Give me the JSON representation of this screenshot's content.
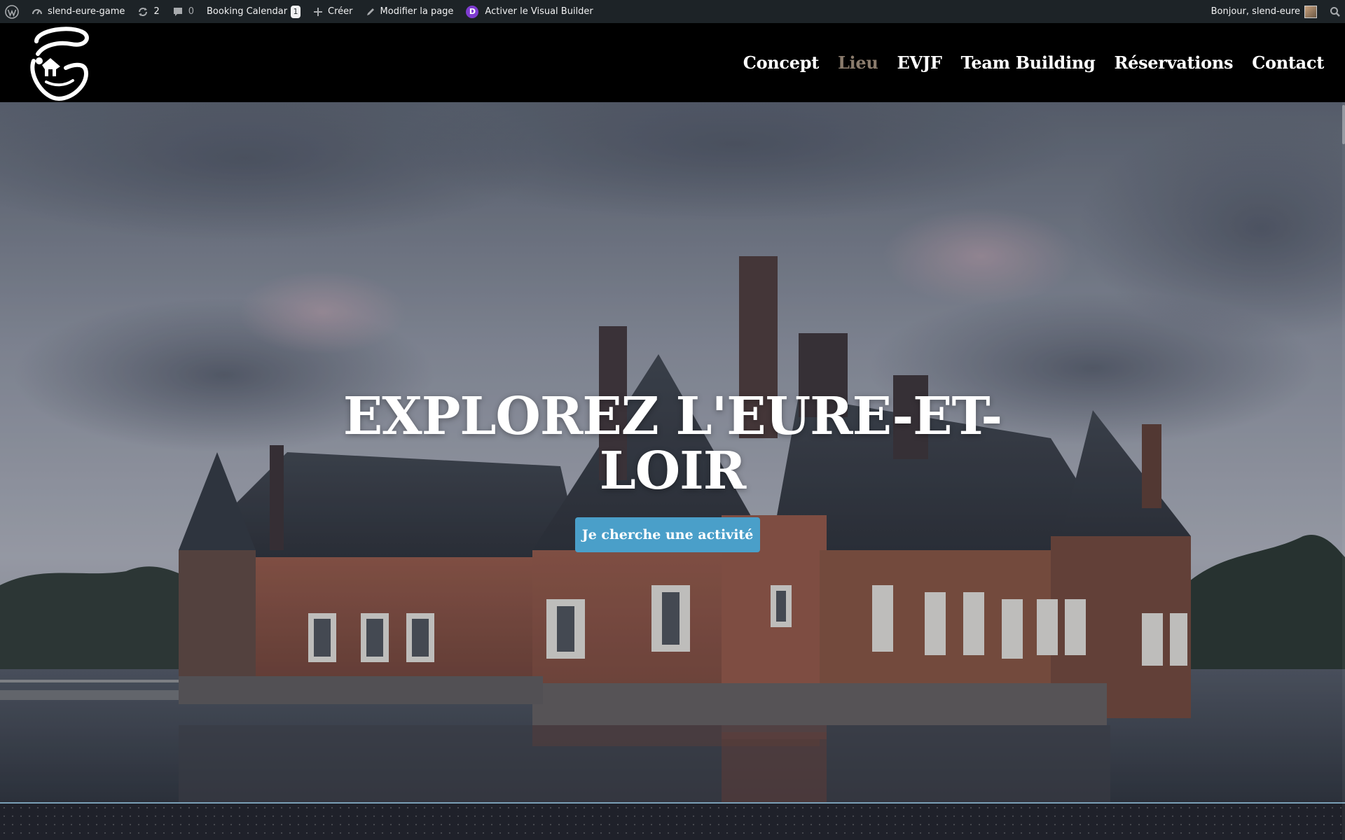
{
  "adminbar": {
    "site_name": "slend-eure-game",
    "updates_count": "2",
    "comments_count": "0",
    "booking_label": "Booking Calendar",
    "booking_badge": "1",
    "create_label": "Créer",
    "edit_label": "Modifier la page",
    "divi_letter": "D",
    "visual_builder_label": "Activer le Visual Builder",
    "greeting": "Bonjour, slend-eure"
  },
  "nav": {
    "items": [
      {
        "label": "Concept"
      },
      {
        "label": "Lieu"
      },
      {
        "label": "EVJF"
      },
      {
        "label": "Team Building"
      },
      {
        "label": "Réservations"
      },
      {
        "label": "Contact"
      }
    ],
    "active_index": 1
  },
  "hero": {
    "title_line1": "EXPLOREZ L'EURE-ET-",
    "title_line2": "LOIR",
    "cta_label": "Je cherche une activité"
  },
  "colors": {
    "adminbar_bg": "#1d2327",
    "header_bg": "#000000",
    "nav_active": "#8a7b6c",
    "cta_bg": "#4a9fc9",
    "divi_purple": "#7e3bd0"
  },
  "icons": [
    "wordpress-icon",
    "dashboard-icon",
    "updates-icon",
    "comments-icon",
    "plus-icon",
    "pencil-icon",
    "divi-icon",
    "search-icon"
  ]
}
